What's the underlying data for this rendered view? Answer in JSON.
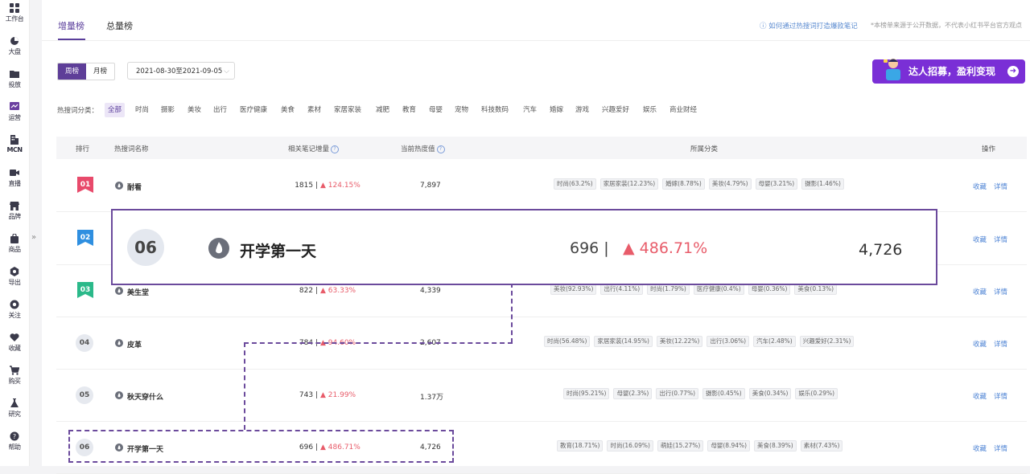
{
  "sidebar": {
    "items": [
      {
        "label": "工作台",
        "icon": "grid-icon"
      },
      {
        "label": "大盘",
        "icon": "pie-chart-icon"
      },
      {
        "label": "投放",
        "icon": "folder-icon"
      },
      {
        "label": "运营",
        "icon": "chart-icon"
      },
      {
        "label": "MCN",
        "icon": "building-icon"
      },
      {
        "label": "直播",
        "icon": "video-icon"
      },
      {
        "label": "品牌",
        "icon": "store-icon"
      },
      {
        "label": "商品",
        "icon": "bag-icon"
      },
      {
        "label": "导出",
        "icon": "export-icon"
      },
      {
        "label": "关注",
        "icon": "eye-icon"
      },
      {
        "label": "收藏",
        "icon": "heart-icon"
      },
      {
        "label": "购买",
        "icon": "cart-icon"
      },
      {
        "label": "研究",
        "icon": "flask-icon"
      },
      {
        "label": "帮助",
        "icon": "help-icon"
      }
    ],
    "collapse_glyph": "»"
  },
  "header": {
    "tabs": [
      {
        "label": "增量榜"
      },
      {
        "label": "总量榜"
      }
    ],
    "help_link": "ⓘ 如何通过热搜词打造爆款笔记",
    "disclaimer": "*本榜单来源于公开数据，不代表小红书平台官方观点"
  },
  "filters": {
    "period_options": [
      "周榜",
      "月榜"
    ],
    "date_range": "2021-08-30至2021-09-05",
    "category_label": "热搜词分类：",
    "categories": [
      "全部",
      "时尚",
      "摄影",
      "美妆",
      "出行",
      "医疗健康",
      "美食",
      "素材",
      "家居家装",
      "减肥",
      "教育",
      "母婴",
      "宠物",
      "科技数码",
      "汽车",
      "婚嫁",
      "游戏",
      "兴趣爱好",
      "娱乐",
      "商业财经"
    ]
  },
  "banner": {
    "text": "达人招募，盈利变现",
    "arrow": "➜"
  },
  "table": {
    "headers": {
      "rank": "排行",
      "keyword": "热搜词名称",
      "notes": "相关笔记增量",
      "heat": "当前热度值",
      "category": "所属分类",
      "action": "操作"
    },
    "qmark": "?",
    "rows": [
      {
        "rank": "01",
        "keyword": "耐看",
        "count": "1815 |",
        "growth": "▲ 124.15%",
        "heat": "7,897",
        "tags": [
          "时尚(63.2%)",
          "家居家装(12.23%)",
          "婚嫁(8.78%)",
          "美妆(4.79%)",
          "母婴(3.21%)",
          "摄影(1.46%)"
        ]
      },
      {
        "rank": "02"
      },
      {
        "rank": "03",
        "keyword": "美生堂",
        "count": "822 |",
        "growth": "▲ 63.33%",
        "heat": "4,339",
        "tags": [
          "美妆(92.93%)",
          "出行(4.11%)",
          "时尚(1.79%)",
          "医疗健康(0.4%)",
          "母婴(0.36%)",
          "美食(0.13%)"
        ]
      },
      {
        "rank": "04",
        "keyword": "皮革",
        "count": "784 |",
        "growth": "▲ 94.60%",
        "heat": "2,607",
        "tags": [
          "时尚(56.48%)",
          "家居家装(14.95%)",
          "美妆(12.22%)",
          "出行(3.06%)",
          "汽车(2.48%)",
          "兴趣爱好(2.31%)"
        ]
      },
      {
        "rank": "05",
        "keyword": "秋天穿什么",
        "count": "743 |",
        "growth": "▲ 21.99%",
        "heat": "1.37万",
        "tags": [
          "时尚(95.21%)",
          "母婴(2.3%)",
          "出行(0.77%)",
          "摄影(0.45%)",
          "美食(0.34%)",
          "娱乐(0.29%)"
        ]
      },
      {
        "rank": "06",
        "keyword": "开学第一天",
        "count": "696 |",
        "growth": "▲ 486.71%",
        "heat": "4,726",
        "tags": [
          "教育(18.71%)",
          "时尚(16.09%)",
          "萌娃(15.27%)",
          "母婴(8.94%)",
          "美食(8.39%)",
          "素材(7.43%)"
        ]
      }
    ],
    "actions": {
      "collect": "收藏",
      "detail": "详情"
    }
  },
  "zoom": {
    "rank": "06",
    "keyword": "开学第一天",
    "count": "696 |",
    "growth": "▲ 486.71%",
    "heat": "4,726"
  },
  "colors": {
    "accent": "#5a3e9b",
    "rank1": "#e84a6b",
    "rank2": "#2f8fe0",
    "rank3": "#2bb98a",
    "growth": "#e85c6a",
    "link": "#4d83d4"
  }
}
